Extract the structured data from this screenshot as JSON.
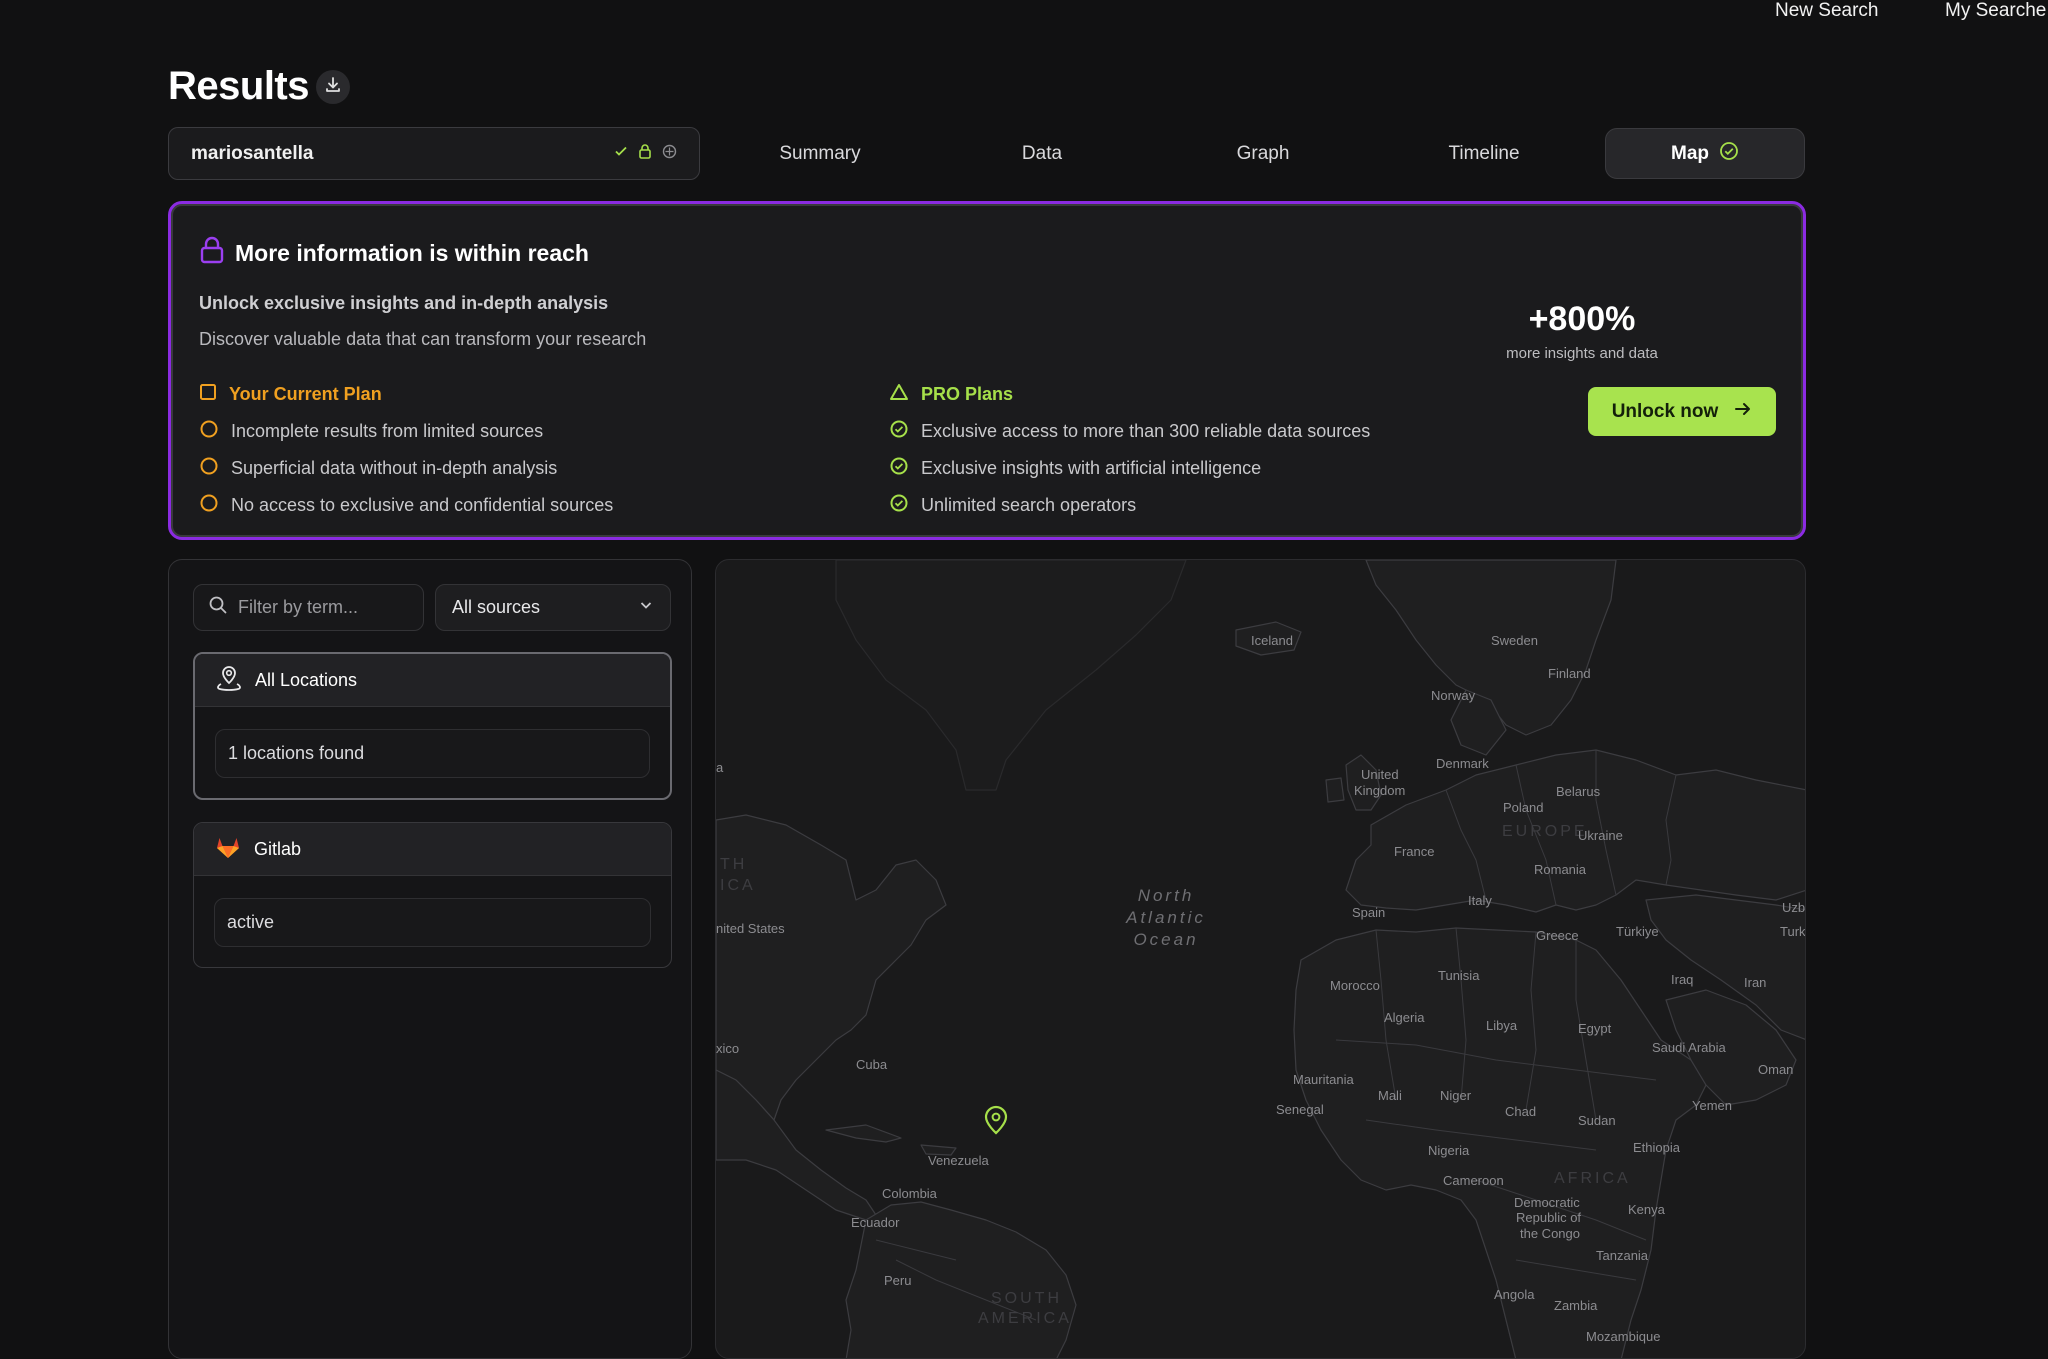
{
  "topnav": {
    "new_search": "New Search",
    "my_searches": "My Searche"
  },
  "header": {
    "title": "Results"
  },
  "search": {
    "term": "mariosantella"
  },
  "tabs": [
    {
      "label": "Summary"
    },
    {
      "label": "Data"
    },
    {
      "label": "Graph"
    },
    {
      "label": "Timeline"
    },
    {
      "label": "Map",
      "active": true
    }
  ],
  "promo": {
    "title": "More information is within reach",
    "subtitle": "Unlock exclusive insights and in-depth analysis",
    "description": "Discover valuable data that can transform your research",
    "current_plan": {
      "heading": "Your Current Plan",
      "items": [
        "Incomplete results from limited sources",
        "Superficial data without in-depth analysis",
        "No access to exclusive and confidential sources"
      ]
    },
    "pro_plan": {
      "heading": "PRO Plans",
      "items": [
        "Exclusive access to more than 300 reliable data sources",
        "Exclusive insights with artificial intelligence",
        "Unlimited search operators"
      ]
    },
    "stat": "+800%",
    "stat_sub": "more insights and data",
    "cta": "Unlock now"
  },
  "sidebar": {
    "filter_placeholder": "Filter by term...",
    "sources_select": "All sources",
    "cards": [
      {
        "title": "All Locations",
        "value": "1 locations found"
      },
      {
        "title": "Gitlab",
        "value": "active"
      }
    ]
  },
  "map": {
    "ocean": [
      "North",
      "Atlantic",
      "Ocean"
    ],
    "regions": {
      "europe": "EUROPE",
      "africa": "AFRICA",
      "south_america_1": "SOUTH",
      "south_america_2": "AMERICA",
      "north_america_1": "TH",
      "north_america_2": "ICA"
    },
    "labels": {
      "iceland": "Iceland",
      "sweden": "Sweden",
      "finland": "Finland",
      "norway": "Norway",
      "denmark": "Denmark",
      "uk_1": "United",
      "uk_2": "Kingdom",
      "poland": "Poland",
      "belarus": "Belarus",
      "ukraine": "Ukraine",
      "france": "France",
      "romania": "Romania",
      "spain": "Spain",
      "italy": "Italy",
      "greece": "Greece",
      "turkiye": "Türkiye",
      "turkmen": "Turkmen",
      "uzb": "Uzb",
      "iraq": "Iraq",
      "iran": "Iran",
      "morocco": "Morocco",
      "tunisia": "Tunisia",
      "algeria": "Algeria",
      "libya": "Libya",
      "egypt": "Egypt",
      "saudi": "Saudi Arabia",
      "oman": "Oman",
      "yemen": "Yemen",
      "mauritania": "Mauritania",
      "mali": "Mali",
      "niger": "Niger",
      "chad": "Chad",
      "sudan": "Sudan",
      "senegal": "Senegal",
      "nigeria": "Nigeria",
      "ethiopia": "Ethiopia",
      "cameroon": "Cameroon",
      "drc_1": "Democratic",
      "drc_2": "Republic of",
      "drc_3": "the Congo",
      "kenya": "Kenya",
      "tanzania": "Tanzania",
      "angola": "Angola",
      "zambia": "Zambia",
      "mozambique": "Mozambique",
      "united_states": "nited States",
      "mexico": "xico",
      "cuba": "Cuba",
      "venezuela": "Venezuela",
      "colombia": "Colombia",
      "ecuador": "Ecuador",
      "peru": "Peru",
      "edge_a": "a"
    }
  },
  "colors": {
    "accent_purple": "#8b2be2",
    "accent_green": "#a8e34e",
    "orange": "#f0a020",
    "pin": "#a6e04a"
  },
  "icons": [
    "download-icon",
    "check-icon",
    "lock-icon",
    "shield-icon",
    "check-circle-icon",
    "square-icon",
    "circle-icon",
    "triangle-icon",
    "arrow-right-icon",
    "search-icon",
    "chevron-down-icon",
    "location-person-icon",
    "gitlab-icon",
    "map-pin-icon"
  ]
}
